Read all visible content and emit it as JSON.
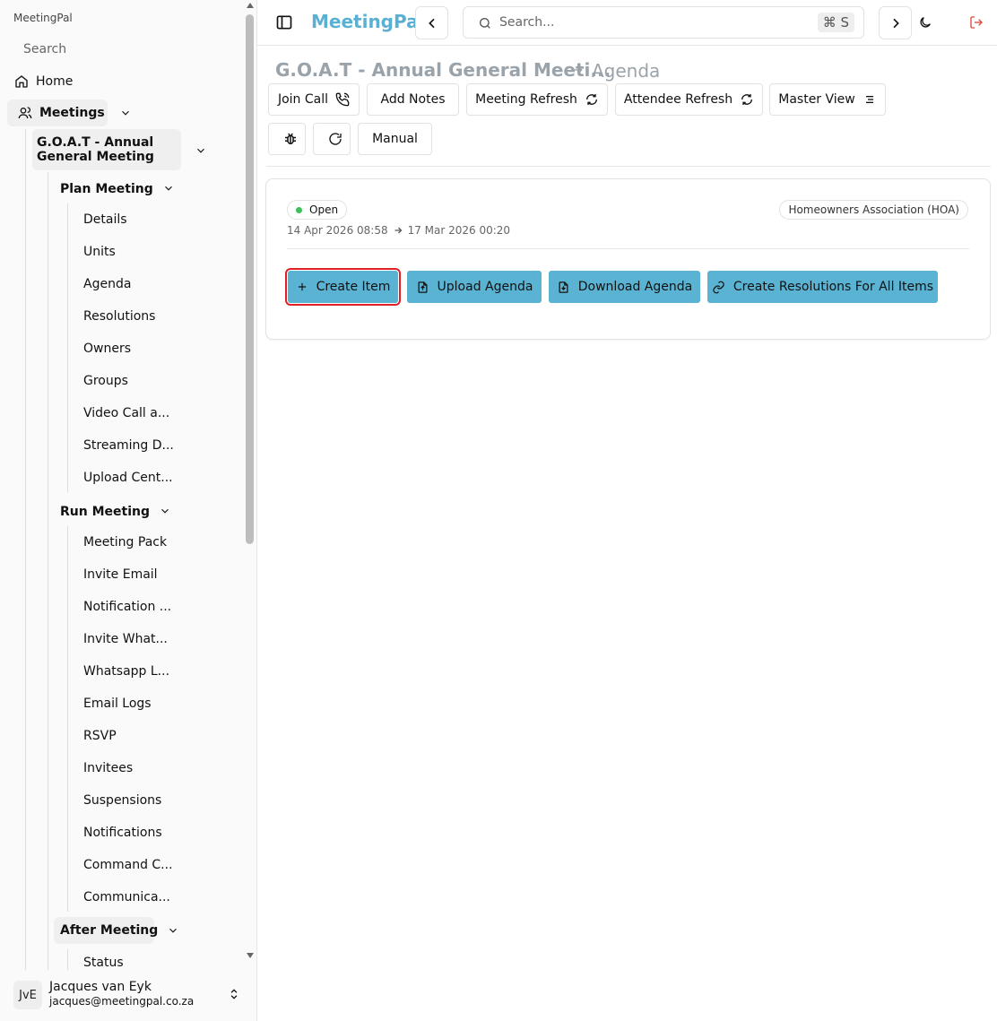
{
  "sidebar": {
    "brand": "MeetingPal",
    "search_placeholder": "Search",
    "home": "Home",
    "meetings": "Meetings",
    "meeting_name": "G.O.A.T - Annual General Meeting",
    "plan_meeting": {
      "label": "Plan Meeting",
      "items": [
        "Details",
        "Units",
        "Agenda",
        "Resolutions",
        "Owners",
        "Groups",
        "Video Call a...",
        "Streaming D...",
        "Upload Cent..."
      ]
    },
    "run_meeting": {
      "label": "Run Meeting",
      "items": [
        "Meeting Pack",
        "Invite Email",
        "Notification ...",
        "Invite What...",
        "Whatsapp L...",
        "Email Logs",
        "RSVP",
        "Invitees",
        "Suspensions",
        "Notifications",
        "Command C...",
        "Communica..."
      ]
    },
    "after_meeting": {
      "label": "After Meeting",
      "items": [
        "Status"
      ]
    },
    "user": {
      "initials": "JvE",
      "name": "Jacques van Eyk",
      "email": "jacques@meetingpal.co.za"
    }
  },
  "topbar": {
    "logo": "MeetingPal",
    "search_placeholder": "Search...",
    "shortcut": "⌘ S"
  },
  "breadcrumb": {
    "parent": "G.O.A.T - Annual General Meeti...",
    "current": "Agenda"
  },
  "actions": {
    "join_call": "Join Call",
    "add_notes": "Add Notes",
    "meeting_refresh": "Meeting Refresh",
    "attendee_refresh": "Attendee Refresh",
    "master_view": "Master View",
    "manual": "Manual"
  },
  "card": {
    "status": "Open",
    "organization": "Homeowners Association (HOA)",
    "start": "14 Apr 2026 08:58",
    "end": "17 Mar 2026 00:20",
    "buttons": {
      "create_item": "Create Item",
      "upload_agenda": "Upload Agenda",
      "download_agenda": "Download Agenda",
      "create_resolutions": "Create Resolutions For All Items"
    }
  },
  "colors": {
    "accent": "#5ab3d2",
    "logo": "#5ab0d3",
    "status_open": "#3fbf5a",
    "logout": "#e0453a",
    "focus": "#e01f26"
  }
}
